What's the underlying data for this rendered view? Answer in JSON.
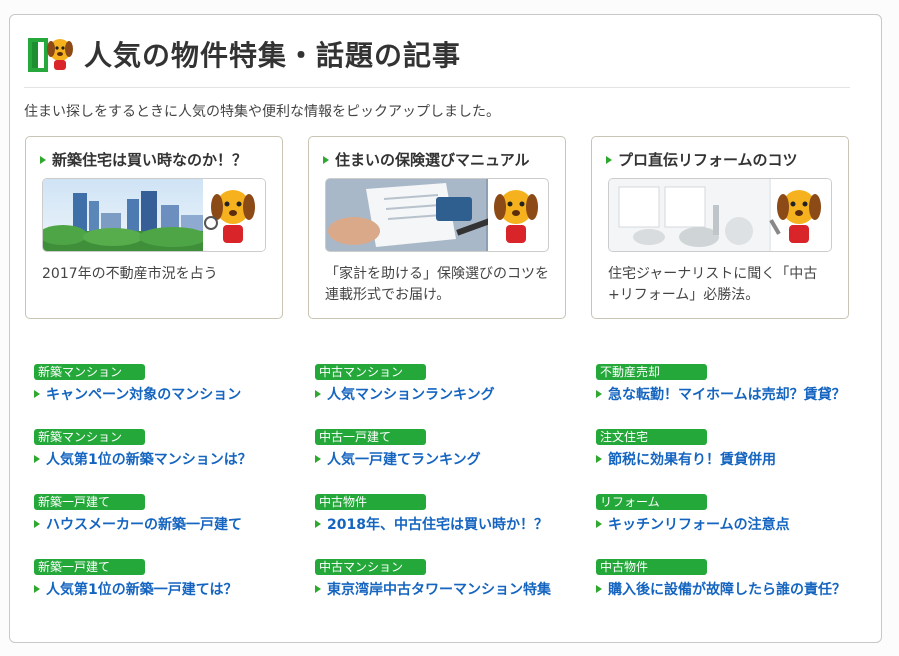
{
  "header": {
    "title": "人気の物件特集・話題の記事",
    "intro": "住まい探しをするときに人気の特集や便利な情報をピックアップしました。"
  },
  "cards": [
    {
      "title": "新築住宅は買い時なのか！？",
      "desc": "2017年の不動産市況を占う",
      "image": "city-skyline-mascot-image"
    },
    {
      "title": "住まいの保険選びマニュアル",
      "desc": "「家計を助ける」保険選びのコツを連載形式でお届け。",
      "image": "documents-mascot-image"
    },
    {
      "title": "プロ直伝リフォームのコツ",
      "desc": "住宅ジャーナリストに聞く「中古+リフォーム」必勝法。",
      "image": "white-room-mascot-image"
    }
  ],
  "links": [
    [
      {
        "tag": "新築マンション",
        "label": "キャンペーン対象のマンション"
      },
      {
        "tag": "新築マンション",
        "label": "人気第1位の新築マンションは？"
      },
      {
        "tag": "新築一戸建て",
        "label": "ハウスメーカーの新築一戸建て"
      },
      {
        "tag": "新築一戸建て",
        "label": "人気第1位の新築一戸建ては？"
      }
    ],
    [
      {
        "tag": "中古マンション",
        "label": "人気マンションランキング"
      },
      {
        "tag": "中古一戸建て",
        "label": "人気一戸建てランキング"
      },
      {
        "tag": "中古物件",
        "label": "2018年、中古住宅は買い時か！？"
      },
      {
        "tag": "中古マンション",
        "label": "東京湾岸中古タワーマンション特集"
      }
    ],
    [
      {
        "tag": "不動産売却",
        "label": "急な転勤！マイホームは売却？賃貸？"
      },
      {
        "tag": "注文住宅",
        "label": "節税に効果有り！賃貸併用"
      },
      {
        "tag": "リフォーム",
        "label": "キッチンリフォームの注意点"
      },
      {
        "tag": "中古物件",
        "label": "購入後に設備が故障したら誰の責任？"
      }
    ]
  ],
  "colors": {
    "accent_green": "#24a83a",
    "link_blue": "#1565c0",
    "mascot_brown": "#8b4a16",
    "mascot_yellow": "#f5b21e"
  }
}
